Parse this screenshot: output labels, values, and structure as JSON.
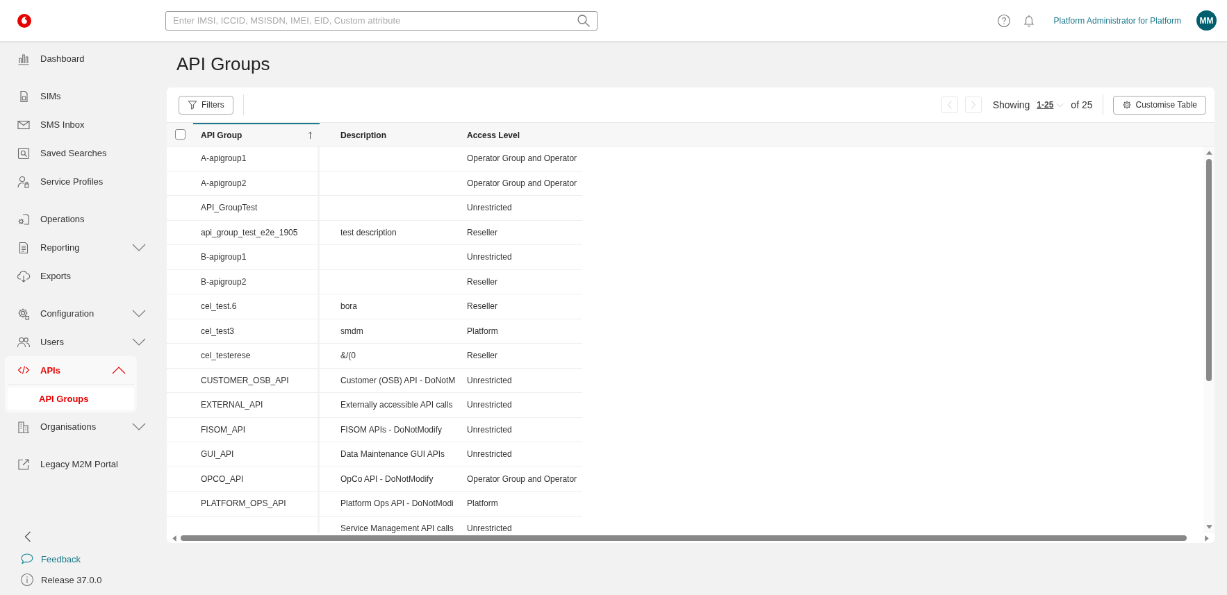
{
  "topbar": {
    "search": {
      "placeholder": "Enter IMSI, ICCID, MSISDN, IMEI, EID, Custom attribute"
    },
    "user": "Platform Administrator for Platform",
    "avatar": "MM"
  },
  "sidebar": {
    "sections": [
      {
        "items": [
          {
            "kind": "link",
            "label": "Dashboard",
            "selected": false
          }
        ]
      },
      {
        "items": [
          {
            "kind": "link",
            "label": "SIMs",
            "selected": false
          },
          {
            "kind": "link",
            "label": "SMS Inbox",
            "selected": false
          },
          {
            "kind": "link",
            "label": "Saved Searches",
            "selected": false
          },
          {
            "kind": "link",
            "label": "Service Profiles",
            "selected": false
          }
        ]
      },
      {
        "items": [
          {
            "kind": "link",
            "label": "Operations",
            "selected": false
          },
          {
            "kind": "group",
            "label": "Reporting",
            "selected": false,
            "expanded": false
          },
          {
            "kind": "link",
            "label": "Exports",
            "selected": false
          }
        ]
      },
      {
        "items": [
          {
            "kind": "group",
            "label": "Configuration",
            "selected": false,
            "expanded": false
          },
          {
            "kind": "group",
            "label": "Users",
            "selected": false,
            "expanded": false
          },
          {
            "kind": "group",
            "label": "APIs",
            "selected": true,
            "expanded": true,
            "children": [
              {
                "label": "API Groups",
                "selected": true
              }
            ]
          },
          {
            "kind": "group",
            "label": "Organisations",
            "selected": false,
            "expanded": false
          }
        ]
      },
      {
        "items": [
          {
            "kind": "link",
            "label": "Legacy M2M Portal",
            "selected": false
          }
        ]
      }
    ],
    "feedback": "Feedback",
    "release": "Release 37.0.0"
  },
  "page": {
    "title": "API Groups"
  },
  "toolbar": {
    "filters": "Filters",
    "prev_disabled": true,
    "next_disabled": true,
    "showing": "Showing",
    "range": "1-25",
    "of": "of 25",
    "customise": "Customise Table"
  },
  "table": {
    "select_all": {
      "checked": false
    },
    "columns": [
      {
        "label": "API Group",
        "sorted": true
      },
      {
        "label": "Description",
        "sorted": false
      },
      {
        "label": "Access Level",
        "sorted": false
      }
    ],
    "rows": [
      {
        "api_group": "A-apigroup1",
        "access_level": "Operator Group and Operator"
      },
      {
        "api_group": "A-apigroup2",
        "access_level": "Operator Group and Operator"
      },
      {
        "api_group": "API_GroupTest",
        "access_level": "Unrestricted"
      },
      {
        "api_group": "api_group_test_e2e_1905",
        "description": "test description",
        "access_level": "Reseller"
      },
      {
        "api_group": "B-apigroup1",
        "access_level": "Unrestricted"
      },
      {
        "api_group": "B-apigroup2",
        "access_level": "Reseller"
      },
      {
        "api_group": "cel_test.6",
        "description": "bora",
        "access_level": "Reseller"
      },
      {
        "api_group": "cel_test3",
        "description": "smdm",
        "access_level": "Platform"
      },
      {
        "api_group": "cel_testerese",
        "description": "&/(0",
        "access_level": "Reseller"
      },
      {
        "api_group": "CUSTOMER_OSB_API",
        "description": "Customer (OSB) API - DoNotM",
        "access_level": "Unrestricted"
      },
      {
        "api_group": "EXTERNAL_API",
        "description": "Externally accessible API calls",
        "access_level": "Unrestricted"
      },
      {
        "api_group": "FISOM_API",
        "description": "FISOM APIs - DoNotModify",
        "access_level": "Unrestricted"
      },
      {
        "api_group": "GUI_API",
        "description": "Data Maintenance GUI APIs",
        "access_level": "Unrestricted"
      },
      {
        "api_group": "OPCO_API",
        "description": "OpCo API - DoNotModify",
        "access_level": "Operator Group and Operator"
      },
      {
        "api_group": "PLATFORM_OPS_API",
        "description": "Platform Ops API - DoNotModi",
        "access_level": "Platform"
      },
      {
        "description": "Service Management API calls",
        "access_level": "Unrestricted"
      }
    ]
  }
}
